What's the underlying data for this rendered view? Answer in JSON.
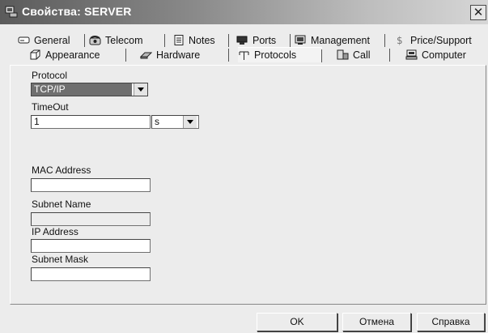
{
  "window": {
    "title": "Свойства: SERVER",
    "close_glyph": "✕"
  },
  "tabs_row1": [
    {
      "label": "General",
      "icon": "drive-icon"
    },
    {
      "label": "Telecom",
      "icon": "telephone-icon"
    },
    {
      "label": "Notes",
      "icon": "notes-icon"
    },
    {
      "label": "Ports",
      "icon": "port-icon"
    },
    {
      "label": "Management",
      "icon": "management-icon"
    },
    {
      "label": "Price/Support",
      "icon": "dollar-icon"
    }
  ],
  "tabs_row2": [
    {
      "label": "Appearance",
      "icon": "cube-icon"
    },
    {
      "label": "Hardware",
      "icon": "hardware-icon"
    },
    {
      "label": "Protocols",
      "icon": "protocol-icon",
      "active": true
    },
    {
      "label": "Call",
      "icon": "call-icon"
    },
    {
      "label": "Computer",
      "icon": "computer-icon"
    }
  ],
  "form": {
    "protocol_label": "Protocol",
    "protocol_value": "TCP/IP",
    "timeout_label": "TimeOut",
    "timeout_value": "1",
    "timeout_unit": "s",
    "mac_label": "MAC Address",
    "mac_value": "",
    "subnet_name_label": "Subnet Name",
    "subnet_name_value": "",
    "ip_label": "IP Address",
    "ip_value": "",
    "subnet_mask_label": "Subnet Mask",
    "subnet_mask_value": ""
  },
  "buttons": {
    "ok": "OK",
    "cancel": "Отмена",
    "help": "Справка"
  }
}
